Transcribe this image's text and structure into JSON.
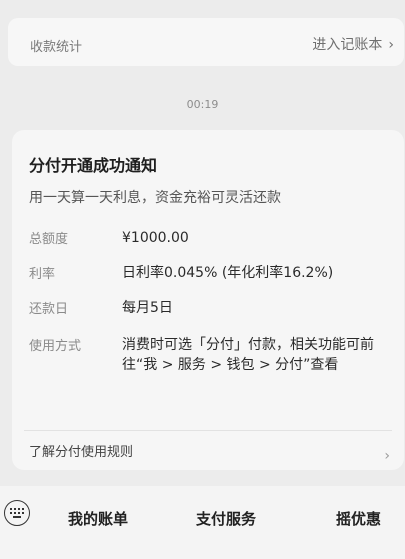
{
  "top_card": {
    "title": "收款统计",
    "action": "进入记账本",
    "chevron": "›"
  },
  "timestamp": "00:19",
  "message": {
    "title": "分付开通成功通知",
    "subtitle": "用一天算一天利息，资金充裕可灵活还款",
    "rows": [
      {
        "label": "总额度",
        "value": "¥1000.00"
      },
      {
        "label": "利率",
        "value": "日利率0.045% (年化利率16.2%)"
      },
      {
        "label": "还款日",
        "value": "每月5日"
      },
      {
        "label": "使用方式",
        "value": "消费时可选「分付」付款，相关功能可前往“我 > 服务 > 钱包 > 分付”查看"
      }
    ],
    "link": "了解分付使用规则",
    "link_chevron": "›"
  },
  "bottom_menu": {
    "items": [
      "我的账单",
      "支付服务",
      "摇优惠"
    ],
    "keyboard_icon": "keyboard-icon"
  }
}
